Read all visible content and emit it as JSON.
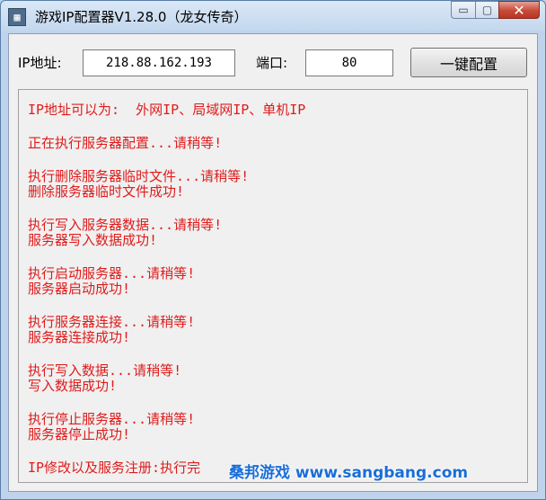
{
  "window": {
    "title": "游戏IP配置器V1.28.0（龙女传奇）",
    "icon": "app-grid-icon",
    "controls": {
      "minimize": "▭",
      "maximize": "▢",
      "close": "✕"
    }
  },
  "form": {
    "ip_label": "IP地址:",
    "ip_value": "218.88.162.193",
    "port_label": "端口:",
    "port_value": "80",
    "config_button": "一键配置"
  },
  "log": {
    "groups": [
      [
        "IP地址可以为:  外网IP、局域网IP、单机IP"
      ],
      [
        "正在执行服务器配置...请稍等!"
      ],
      [
        "执行删除服务器临时文件...请稍等!",
        "删除服务器临时文件成功!"
      ],
      [
        "执行写入服务器数据...请稍等!",
        "服务器写入数据成功!"
      ],
      [
        "执行启动服务器...请稍等!",
        "服务器启动成功!"
      ],
      [
        "执行服务器连接...请稍等!",
        "服务器连接成功!"
      ],
      [
        "执行写入数据...请稍等!",
        "写入数据成功!"
      ],
      [
        "执行停止服务器...请稍等!",
        "服务器停止成功!"
      ],
      [
        "IP修改以及服务注册:执行完"
      ]
    ]
  },
  "watermark": "桑邦游戏 www.sangbang.com",
  "colors": {
    "log_text": "#e01b1b",
    "watermark": "#1a6ed8",
    "close_button": "#c74a39"
  }
}
